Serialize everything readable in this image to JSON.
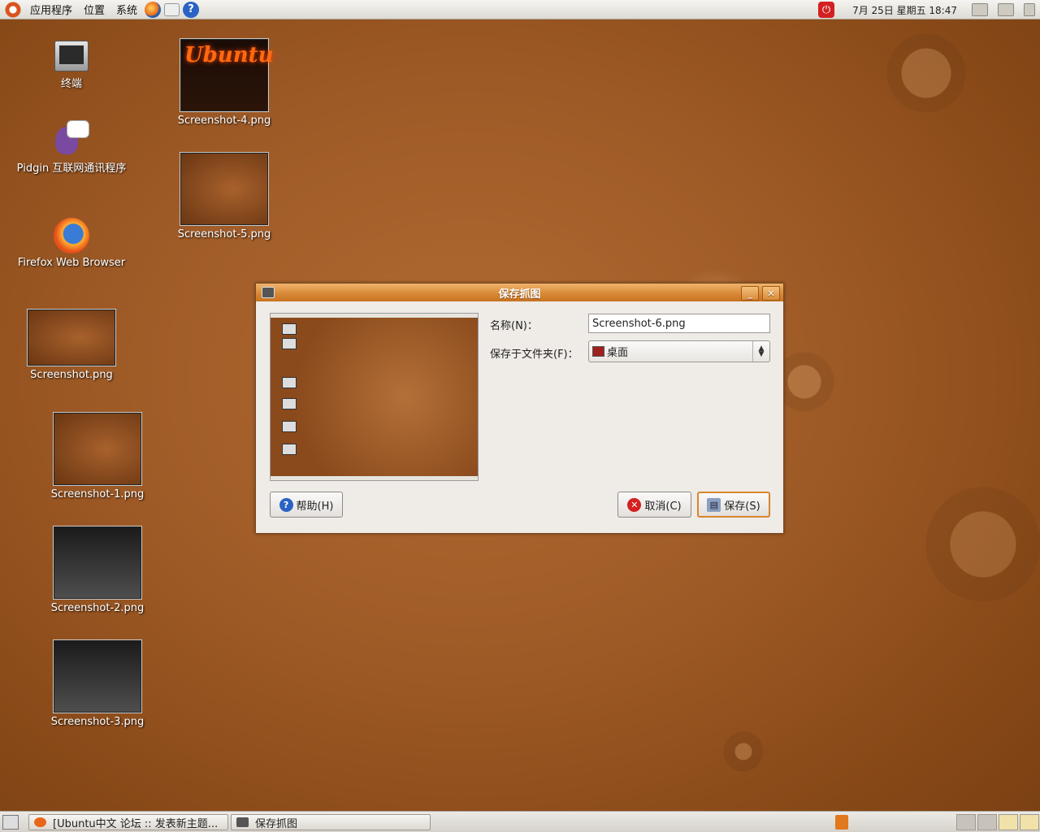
{
  "top_panel": {
    "menus": [
      "应用程序",
      "位置",
      "系统"
    ],
    "launchers": [
      "firefox-icon",
      "mail-icon",
      "help-icon"
    ],
    "clock": "7月 25日 星期五 18:47"
  },
  "desktop": {
    "items": [
      {
        "label": "终端",
        "icon": "terminal-icon"
      },
      {
        "label": "Pidgin 互联网通讯程序",
        "icon": "pidgin-icon"
      },
      {
        "label": "Firefox Web Browser",
        "icon": "firefox-icon"
      },
      {
        "label": "Screenshot.png",
        "icon": "image-thumbnail"
      },
      {
        "label": "Screenshot-1.png",
        "icon": "image-thumbnail"
      },
      {
        "label": "Screenshot-2.png",
        "icon": "image-thumbnail"
      },
      {
        "label": "Screenshot-3.png",
        "icon": "image-thumbnail"
      },
      {
        "label": "Screenshot-4.png",
        "icon": "image-thumbnail",
        "thumb_text": "Ubuntu"
      },
      {
        "label": "Screenshot-5.png",
        "icon": "image-thumbnail"
      }
    ]
  },
  "dialog": {
    "title": "保存抓图",
    "name_label": "名称(N)：",
    "name_value": "Screenshot-6.png",
    "folder_label": "保存于文件夹(F)：",
    "folder_value": "桌面",
    "help_button": "帮助(H)",
    "cancel_button": "取消(C)",
    "save_button": "保存(S)"
  },
  "bottom_panel": {
    "tasks": [
      "[Ubuntu中文 论坛 :: 发表新主题...",
      "保存抓图"
    ]
  },
  "colors": {
    "titlebar": "#d98a38",
    "desktop": "#9e5a26",
    "dialog_bg": "#efebe7"
  }
}
